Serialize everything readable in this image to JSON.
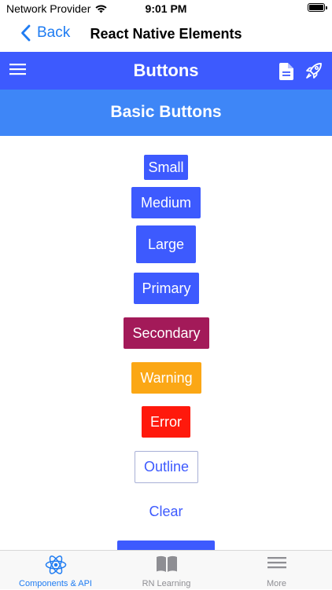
{
  "status_bar": {
    "carrier": "Network Provider",
    "time": "9:01 PM"
  },
  "nav": {
    "back_label": "Back",
    "title": "React Native Elements"
  },
  "header": {
    "title": "Buttons"
  },
  "section": {
    "title": "Basic Buttons"
  },
  "buttons": {
    "small": "Small",
    "medium": "Medium",
    "large": "Large",
    "primary": "Primary",
    "secondary": "Secondary",
    "warning": "Warning",
    "error": "Error",
    "outline": "Outline",
    "clear": "Clear"
  },
  "tabs": [
    {
      "label": "Components & API",
      "icon": "react-icon",
      "active": true
    },
    {
      "label": "RN Learning",
      "icon": "book-icon",
      "active": false
    },
    {
      "label": "More",
      "icon": "menu-icon",
      "active": false
    }
  ],
  "colors": {
    "primary": "#3d5afe",
    "section": "#3e86f7",
    "secondary": "#a31a59",
    "warning": "#fba715",
    "error": "#ff190c",
    "link": "#1f7cf2"
  }
}
